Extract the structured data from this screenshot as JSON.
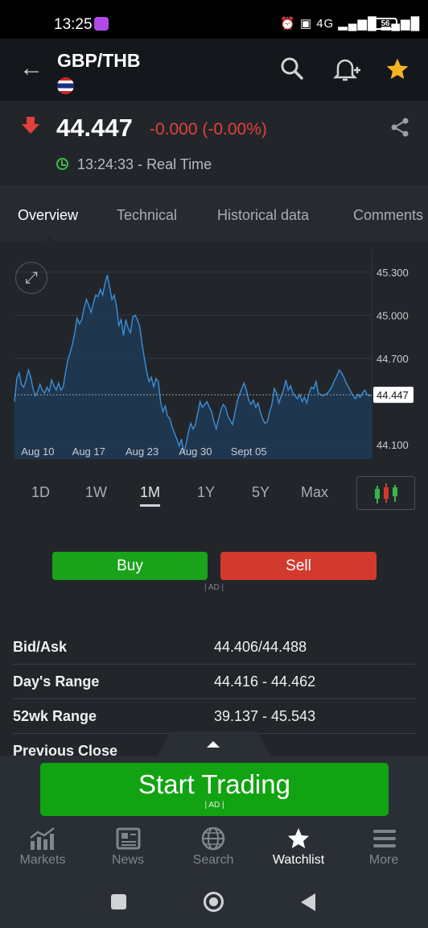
{
  "status_bar": {
    "time": "13:25",
    "network": "4G",
    "battery": "56"
  },
  "header": {
    "pair": "GBP/THB",
    "flag": "thailand-flag-icon"
  },
  "quote": {
    "price": "44.447",
    "change": "-0.000 (-0.00%)",
    "timestamp": "13:24:33 - Real Time",
    "direction_color": "#e0413b"
  },
  "tabs": [
    "Overview",
    "Technical",
    "Historical data",
    "Comments"
  ],
  "chart_data": {
    "type": "area",
    "y_tick_labels": [
      "45.300",
      "45.000",
      "44.700",
      "44.100"
    ],
    "x_tick_labels": [
      "Aug 10",
      "Aug 17",
      "Aug 23",
      "Aug 30",
      "Sept 05"
    ],
    "current_price_label": "44.447",
    "ylim": [
      44.0,
      45.4
    ],
    "grid": true,
    "line_color": "#3a8fd9",
    "values": [
      44.4,
      44.56,
      44.6,
      44.52,
      44.5,
      44.55,
      44.62,
      44.57,
      44.49,
      44.44,
      44.47,
      44.52,
      44.48,
      44.46,
      44.5,
      44.47,
      44.55,
      44.51,
      44.48,
      44.53,
      44.48,
      44.5,
      44.6,
      44.69,
      44.74,
      44.8,
      44.88,
      44.98,
      44.94,
      44.97,
      45.05,
      45.11,
      45.07,
      45.02,
      45.08,
      45.14,
      45.13,
      45.18,
      45.14,
      45.22,
      45.28,
      45.2,
      45.11,
      45.14,
      45.06,
      44.93,
      44.97,
      44.86,
      44.97,
      44.91,
      44.88,
      44.99,
      45.0,
      44.97,
      44.92,
      44.8,
      44.7,
      44.61,
      44.54,
      44.57,
      44.5,
      44.56,
      44.54,
      44.4,
      44.33,
      44.37,
      44.3,
      44.28,
      44.22,
      44.18,
      44.14,
      44.09,
      44.14,
      44.04,
      44.11,
      44.19,
      44.25,
      44.21,
      44.24,
      44.32,
      44.4,
      44.36,
      44.38,
      44.4,
      44.36,
      44.33,
      44.26,
      44.21,
      44.28,
      44.34,
      44.38,
      44.36,
      44.3,
      44.27,
      44.24,
      44.32,
      44.4,
      44.45,
      44.49,
      44.53,
      44.48,
      44.41,
      44.38,
      44.41,
      44.36,
      44.39,
      44.33,
      44.28,
      44.25,
      44.26,
      44.33,
      44.38,
      44.49,
      44.46,
      44.39,
      44.44,
      44.48,
      44.55,
      44.48,
      44.51,
      44.46,
      44.44,
      44.42,
      44.45,
      44.4,
      44.43,
      44.39,
      44.46,
      44.5,
      44.49,
      44.54,
      44.46,
      44.45,
      44.44,
      44.45,
      44.46,
      44.48,
      44.51,
      44.55,
      44.58,
      44.62,
      44.6,
      44.57,
      44.53,
      44.5,
      44.47,
      44.44,
      44.42,
      44.45,
      44.43,
      44.46,
      44.48,
      44.45,
      44.44,
      44.447
    ]
  },
  "ranges": [
    "1D",
    "1W",
    "1M",
    "1Y",
    "5Y",
    "Max"
  ],
  "active_range": "1M",
  "trade": {
    "buy": "Buy",
    "sell": "Sell",
    "ad": "| AD |"
  },
  "stats": [
    {
      "label": "Bid/Ask",
      "value": "44.406/44.488"
    },
    {
      "label": "Day's Range",
      "value": "44.416 - 44.462"
    },
    {
      "label": "52wk Range",
      "value": "39.137 - 45.543"
    },
    {
      "label": "Previous Close",
      "value": ""
    }
  ],
  "banner": {
    "cta": "Start Trading",
    "ad": "| AD |"
  },
  "bottom_nav": [
    {
      "label": "Markets",
      "icon": "markets-icon"
    },
    {
      "label": "News",
      "icon": "news-icon"
    },
    {
      "label": "Search",
      "icon": "globe-icon"
    },
    {
      "label": "Watchlist",
      "icon": "star-icon"
    },
    {
      "label": "More",
      "icon": "menu-icon"
    }
  ],
  "colors": {
    "buy": "#1aa31a",
    "sell": "#d33a2e",
    "accent_star": "#f5b324",
    "positive_clock": "#3fbf4a"
  }
}
